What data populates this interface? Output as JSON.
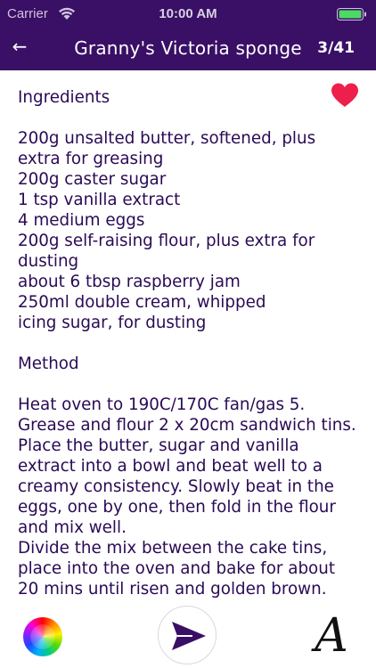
{
  "status_bar": {
    "carrier": "Carrier",
    "time": "10:00 AM",
    "wifi_icon": "wifi-icon",
    "battery_icon": "battery-icon"
  },
  "nav": {
    "back_icon": "back-arrow-icon",
    "back_glyph": "←",
    "title": "Granny's Victoria sponge",
    "counter": "3/41"
  },
  "recipe": {
    "favorite_icon": "heart-icon",
    "favorite_color": "#ee1f4a",
    "ingredients_heading": "Ingredients",
    "ingredients": [
      "200g unsalted butter, softened, plus extra for greasing",
      "200g caster sugar",
      "1 tsp vanilla extract",
      "4 medium eggs",
      "200g self-raising flour, plus extra for dusting",
      "about 6 tbsp raspberry jam",
      "250ml double cream, whipped",
      "icing sugar, for dusting"
    ],
    "method_heading": "Method",
    "method": [
      "Heat oven to 190C/170C fan/gas 5. Grease and flour 2 x 20cm sandwich tins. Place the butter, sugar and vanilla extract into a bowl and beat well to a creamy consistency. Slowly beat in the eggs, one by one, then fold in the flour and mix well.",
      "Divide the mix between the cake tins, place into the oven and bake for about 20 mins until risen and golden brown."
    ]
  },
  "toolbar": {
    "color_icon": "color-wheel-icon",
    "send_icon": "send-icon",
    "font_icon": "font-icon",
    "font_glyph": "A"
  },
  "colors": {
    "bar_background": "#3a0f66",
    "text": "#2a0a55",
    "send_arrow": "#3a0f66"
  }
}
